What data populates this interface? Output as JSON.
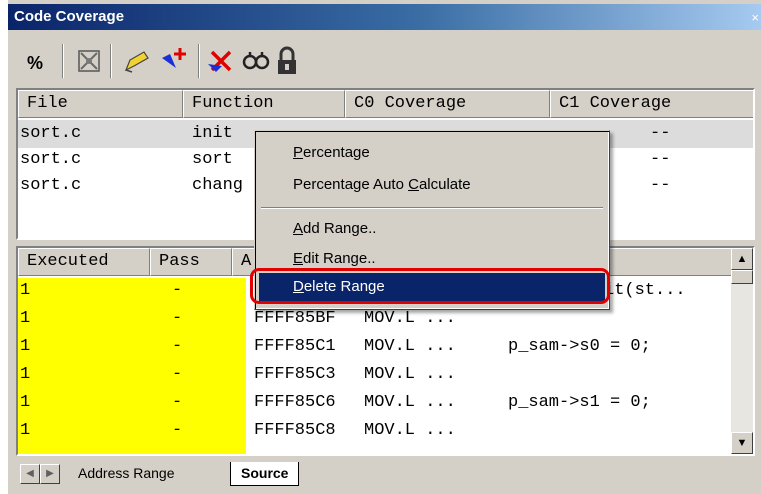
{
  "window": {
    "title": "Code Coverage",
    "close_glyph": "×"
  },
  "toolbar": {
    "buttons": [
      {
        "name": "percent-icon",
        "label": "%"
      },
      {
        "name": "coverage-wrench-icon"
      },
      {
        "name": "edit-range-icon"
      },
      {
        "name": "add-range-icon"
      },
      {
        "name": "delete-range-icon"
      },
      {
        "name": "find-icon"
      },
      {
        "name": "lock-icon"
      }
    ]
  },
  "coverage_table": {
    "columns": [
      "File",
      "Function",
      "C0 Coverage",
      "C1 Coverage"
    ],
    "rows": [
      {
        "file": "sort.c",
        "function": "init",
        "c1": "--"
      },
      {
        "file": "sort.c",
        "function": "sort",
        "c1": "--"
      },
      {
        "file": "sort.c",
        "function": "chang",
        "c1": "--"
      }
    ]
  },
  "source_table": {
    "columns": [
      "Executed",
      "Pass",
      "A"
    ],
    "rows": [
      {
        "executed": "1",
        "pass": "-",
        "addr": "F",
        "instr": "",
        "source": "it(st..."
      },
      {
        "executed": "1",
        "pass": "-",
        "addr": "FFFF85BF",
        "instr": "MOV.L ...",
        "source": ""
      },
      {
        "executed": "1",
        "pass": "-",
        "addr": "FFFF85C1",
        "instr": "MOV.L ...",
        "source": "p_sam->s0 = 0;"
      },
      {
        "executed": "1",
        "pass": "-",
        "addr": "FFFF85C3",
        "instr": "MOV.L ...",
        "source": ""
      },
      {
        "executed": "1",
        "pass": "-",
        "addr": "FFFF85C6",
        "instr": "MOV.L ...",
        "source": "p_sam->s1 = 0;"
      },
      {
        "executed": "1",
        "pass": "-",
        "addr": "FFFF85C8",
        "instr": "MOV.L ...",
        "source": ""
      }
    ]
  },
  "context_menu": {
    "items": [
      {
        "pre": "",
        "key": "P",
        "post": "ercentage"
      },
      {
        "pre": "Percentage Auto ",
        "key": "C",
        "post": "alculate"
      },
      {
        "pre": "",
        "key": "A",
        "post": "dd Range.."
      },
      {
        "pre": "",
        "key": "E",
        "post": "dit Range.."
      },
      {
        "pre": "",
        "key": "D",
        "post": "elete Range"
      }
    ]
  },
  "tabs": {
    "items": [
      "Address Range",
      "Source"
    ],
    "active": "Source"
  },
  "colors": {
    "executed_highlight": "#ffff00",
    "menu_highlight": "#0a246a",
    "annotation_ring": "#e00000"
  }
}
